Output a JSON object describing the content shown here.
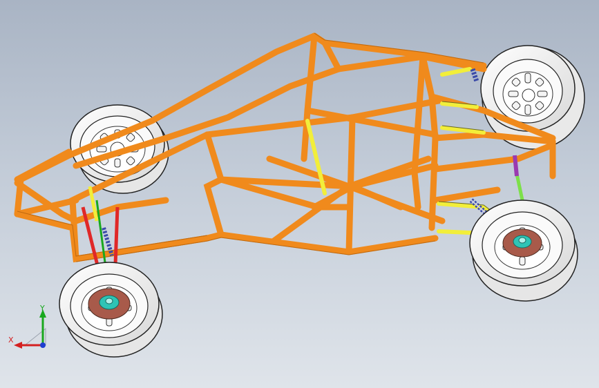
{
  "app": {
    "view": "isometric-3d-model"
  },
  "triad": {
    "x_label": "X",
    "y_label": "Y",
    "x_color": "#d42020",
    "y_color": "#19a81e",
    "z_color": "#1f3fd0"
  },
  "colors": {
    "frame": "#f08a1c",
    "frame_dark": "#b55e08",
    "control_arm": "#f2ee3a",
    "tie_rod": "#7de04a",
    "tire": "#f2f2f2",
    "rim": "#ffffff",
    "brake_disc": "#a85a4a",
    "hub": "#2ec4b6",
    "spring": "#3a4aa8",
    "red_link": "#e02828"
  },
  "model": {
    "wheels": [
      "front-left-wheel",
      "front-right-wheel",
      "rear-left-wheel",
      "rear-right-wheel"
    ]
  }
}
